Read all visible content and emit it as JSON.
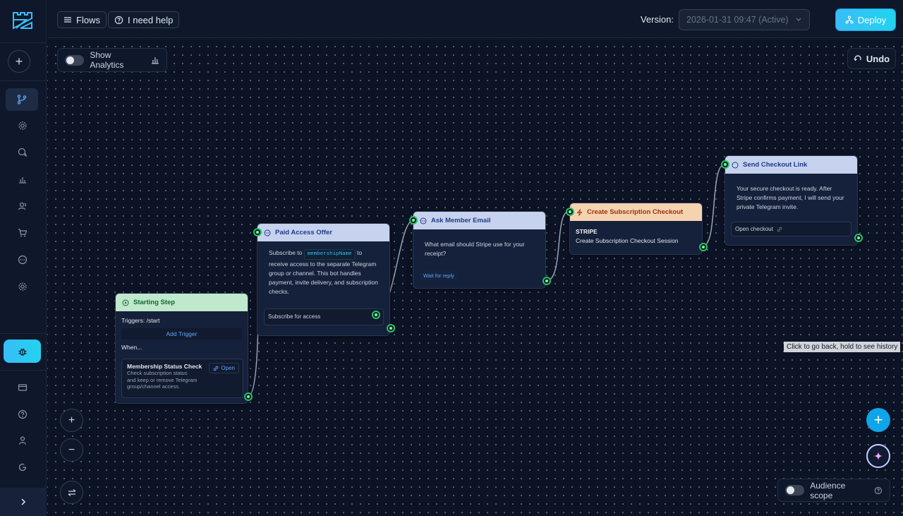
{
  "header": {
    "flows_label": "Flows",
    "help_label": "I need help",
    "version_label": "Version:",
    "version_value": "2026-01-31 09:47 (Active)",
    "deploy_label": "Deploy"
  },
  "canvas": {
    "analytics_label": "Show Analytics",
    "undo_label": "Undo",
    "tooltip": "Click to go back, hold to see history",
    "audience_label": "Audience scope"
  },
  "nodes": {
    "starting": {
      "title": "Starting Step",
      "triggers": "Triggers: /start",
      "add_trigger": "Add Trigger",
      "when": "When...",
      "check_title": "Membership Status Check",
      "check_desc": "Check subscription status and keep or remove Telegram group/channel access.",
      "open_label": "Open"
    },
    "paid_offer": {
      "title": "Paid Access Offer",
      "text_before": "Subscribe to",
      "variable": "membershipName",
      "text_after": "to receive access to the separate Telegram group or channel. This bot handles payment, invite delivery, and subscription checks.",
      "button": "Subscribe for access"
    },
    "ask_email": {
      "title": "Ask Member Email",
      "text": "What email should Stripe use for your receipt?",
      "tag": "Wait for reply"
    },
    "checkout": {
      "title": "Create Subscription Checkout",
      "provider": "STRIPE",
      "action": "Create Subscription Checkout Session"
    },
    "send_link": {
      "title": "Send Checkout Link",
      "text": "Your secure checkout is ready. After Stripe confirms payment, I will send your private Telegram invite.",
      "button": "Open checkout"
    }
  }
}
